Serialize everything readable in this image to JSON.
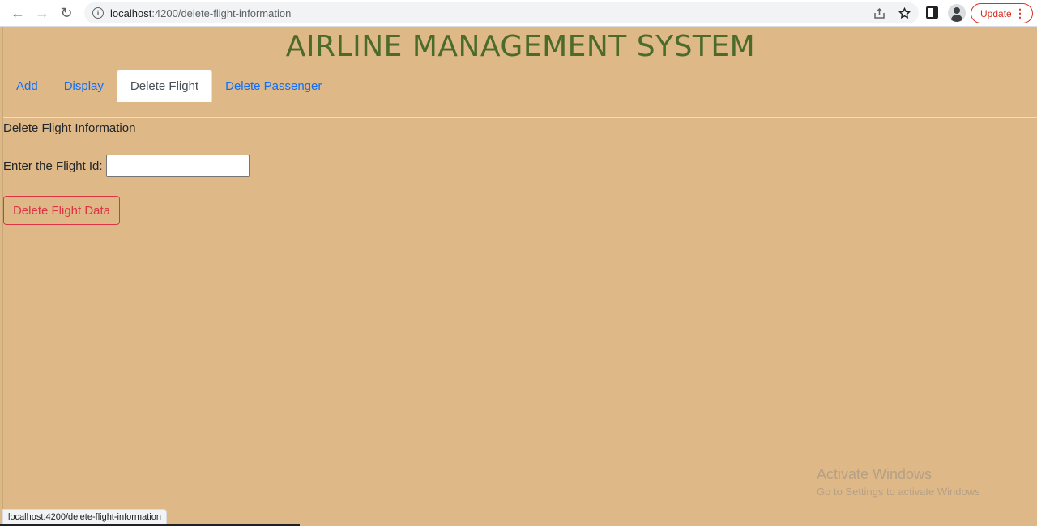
{
  "browser": {
    "url_host": "localhost",
    "url_path": ":4200/delete-flight-information",
    "update_label": "Update",
    "status_url": "localhost:4200/delete-flight-information"
  },
  "page": {
    "title": "AIRLINE MANAGEMENT SYSTEM",
    "tabs": [
      {
        "label": "Add",
        "active": false
      },
      {
        "label": "Display",
        "active": false
      },
      {
        "label": "Delete Flight",
        "active": true
      },
      {
        "label": "Delete Passenger",
        "active": false
      }
    ],
    "section_heading": "Delete Flight Information",
    "flight_id_label": "Enter the Flight Id:",
    "flight_id_value": "",
    "delete_button_label": "Delete Flight Data"
  },
  "watermark": {
    "title": "Activate Windows",
    "subtitle": "Go to Settings to activate Windows"
  },
  "colors": {
    "page_background": "#deb887",
    "title": "#4a6b2a",
    "tab_link": "#0d6efd",
    "danger": "#dc3545"
  }
}
